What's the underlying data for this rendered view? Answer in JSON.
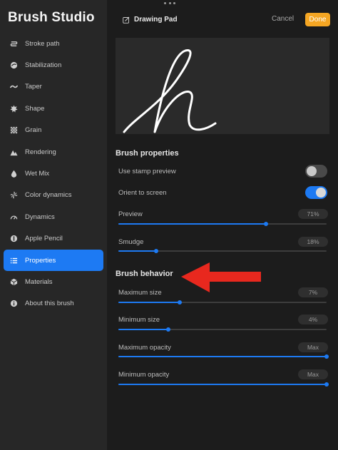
{
  "sidebar": {
    "title": "Brush Studio",
    "items": [
      {
        "label": "Stroke path",
        "icon": "stroke-path-icon"
      },
      {
        "label": "Stabilization",
        "icon": "stabilization-icon"
      },
      {
        "label": "Taper",
        "icon": "taper-icon"
      },
      {
        "label": "Shape",
        "icon": "shape-icon"
      },
      {
        "label": "Grain",
        "icon": "grain-icon"
      },
      {
        "label": "Rendering",
        "icon": "rendering-icon"
      },
      {
        "label": "Wet Mix",
        "icon": "droplet-icon"
      },
      {
        "label": "Color dynamics",
        "icon": "color-dynamics-icon"
      },
      {
        "label": "Dynamics",
        "icon": "gauge-icon"
      },
      {
        "label": "Apple Pencil",
        "icon": "pencil-icon"
      },
      {
        "label": "Properties",
        "icon": "list-icon",
        "active": true
      },
      {
        "label": "Materials",
        "icon": "cube-icon"
      },
      {
        "label": "About this brush",
        "icon": "info-icon"
      }
    ]
  },
  "header": {
    "pad_title": "Drawing Pad",
    "cancel_label": "Cancel",
    "done_label": "Done"
  },
  "properties": {
    "section_title": "Brush properties",
    "use_stamp_preview": {
      "label": "Use stamp preview",
      "on": false
    },
    "orient_to_screen": {
      "label": "Orient to screen",
      "on": true
    },
    "preview": {
      "label": "Preview",
      "value_text": "71%",
      "value": 0.71
    },
    "smudge": {
      "label": "Smudge",
      "value_text": "18%",
      "value": 0.18
    }
  },
  "behavior": {
    "section_title": "Brush behavior",
    "maximum_size": {
      "label": "Maximum size",
      "value_text": "7%",
      "value": 0.295
    },
    "minimum_size": {
      "label": "Minimum size",
      "value_text": "4%",
      "value": 0.24
    },
    "maximum_opacity": {
      "label": "Maximum opacity",
      "value_text": "Max",
      "value": 1.0
    },
    "minimum_opacity": {
      "label": "Minimum opacity",
      "value_text": "Max",
      "value": 1.0
    }
  },
  "colors": {
    "accent": "#1d7af3",
    "done": "#f5a623",
    "annotation": "#e8281e"
  }
}
